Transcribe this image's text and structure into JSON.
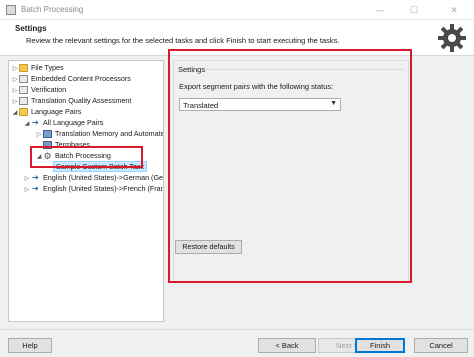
{
  "window": {
    "title": "Batch Processing",
    "icon": "app-icon",
    "controls": [
      "minimize-icon",
      "maximize-icon",
      "close-icon"
    ]
  },
  "header": {
    "title": "Settings",
    "description": "Review the relevant settings for the selected tasks and click Finish to start executing the tasks.",
    "icon": "gear-icon"
  },
  "tree": {
    "items": [
      {
        "label": "File Types",
        "icon": "folder-icon",
        "expander": "▷"
      },
      {
        "label": "Embedded Content Processors",
        "icon": "page-icon",
        "expander": "▷"
      },
      {
        "label": "Verification",
        "icon": "check-icon",
        "expander": "▷"
      },
      {
        "label": "Translation Quality Assessment",
        "icon": "page-icon",
        "expander": "▷"
      },
      {
        "label": "Language Pairs",
        "icon": "folder-icon",
        "expander": "◢"
      },
      {
        "label": "All Language Pairs",
        "icon": "arrow-icon",
        "expander": "◢"
      },
      {
        "label": "Translation Memory and Automated",
        "icon": "book-icon",
        "expander": "▷"
      },
      {
        "label": "Termbases",
        "icon": "book-icon",
        "expander": ""
      },
      {
        "label": "Batch Processing",
        "icon": "gear-icon",
        "expander": "◢"
      },
      {
        "label": "Sample Custom Batch Task",
        "icon": "",
        "expander": "",
        "selected": true
      },
      {
        "label": "English (United States)->German (Germ",
        "icon": "arrow-icon",
        "expander": "▷"
      },
      {
        "label": "English (United States)->French (France",
        "icon": "arrow-icon",
        "expander": "▷"
      }
    ]
  },
  "settings": {
    "group_title": "Settings",
    "status_label": "Export segment pairs with the following status:",
    "status_value": "Translated",
    "restore_label": "Restore defaults"
  },
  "footer": {
    "help": "Help",
    "back": "< Back",
    "next": "Next >",
    "finish": "Finish",
    "cancel": "Cancel"
  },
  "colors": {
    "annotation": "#d81b2a",
    "selection": "#cce8ff",
    "accent": "#0078d7"
  }
}
